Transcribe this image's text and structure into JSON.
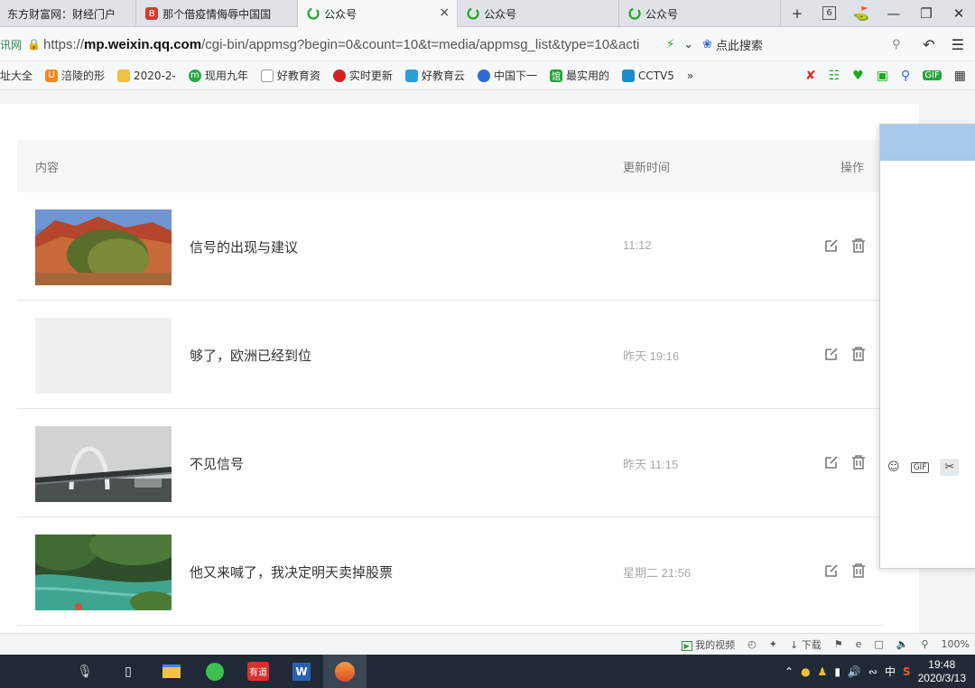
{
  "tabs": [
    {
      "label": "东方财富网：财经门户",
      "icon": "globe-icon"
    },
    {
      "label": "那个借疫情侮辱中国国",
      "icon": "red-logo-icon"
    },
    {
      "label": "公众号",
      "icon": "wechat-icon",
      "active": true
    },
    {
      "label": "公众号",
      "icon": "wechat-icon"
    },
    {
      "label": "公众号",
      "icon": "wechat-icon"
    }
  ],
  "tab_actions": {
    "count": "6"
  },
  "address": {
    "site_label": "讯网",
    "url_prefix": "https://",
    "url_host": "mp.weixin.qq.com",
    "url_path": "/cgi-bin/appmsg?begin=0&count=10&t=media/appmsg_list&type=10&acti",
    "search_label": "点此搜索"
  },
  "bookmarks": [
    {
      "label": "网址大全",
      "icon_color": "#2f7fd6"
    },
    {
      "label": "涪陵的形",
      "icon_color": "#f08a24"
    },
    {
      "label": "2020-2-",
      "icon_color": "#f0c040"
    },
    {
      "label": "现用九年",
      "icon_color": "#27a844"
    },
    {
      "label": "好教育资",
      "icon_color": "#999999"
    },
    {
      "label": "实时更新",
      "icon_color": "#d42020"
    },
    {
      "label": "好教育云",
      "icon_color": "#2aa0d8"
    },
    {
      "label": "中国下一",
      "icon_color": "#2f6bd6"
    },
    {
      "label": "最实用的",
      "icon_color": "#29a33b"
    },
    {
      "label": "CCTV5",
      "icon_color": "#1a8ccf"
    }
  ],
  "bookmark_more": "»",
  "table": {
    "header_content": "内容",
    "header_time": "更新时间",
    "header_op": "操作",
    "rows": [
      {
        "title": "信号的出现与建议",
        "time": "11:12",
        "thumb": "canyon-shrub"
      },
      {
        "title": "够了，欧洲已经到位",
        "time": "昨天 19:16",
        "thumb": "blank"
      },
      {
        "title": "不见信号",
        "time": "昨天 11:15",
        "thumb": "bridge-arch"
      },
      {
        "title": "他又来喊了，我决定明天卖掉股票",
        "time": "星期二 21:56",
        "thumb": "river-forest"
      }
    ]
  },
  "chat": {
    "header_color": "#a6c9ec",
    "gif_label": "GIF"
  },
  "statusbar": {
    "video_label": "我的视频",
    "download_label": "下载",
    "zoom": "100%"
  },
  "taskbar": {
    "time": "19:48",
    "date": "2020/3/13",
    "ime": "中",
    "youdao_label": "有道"
  }
}
